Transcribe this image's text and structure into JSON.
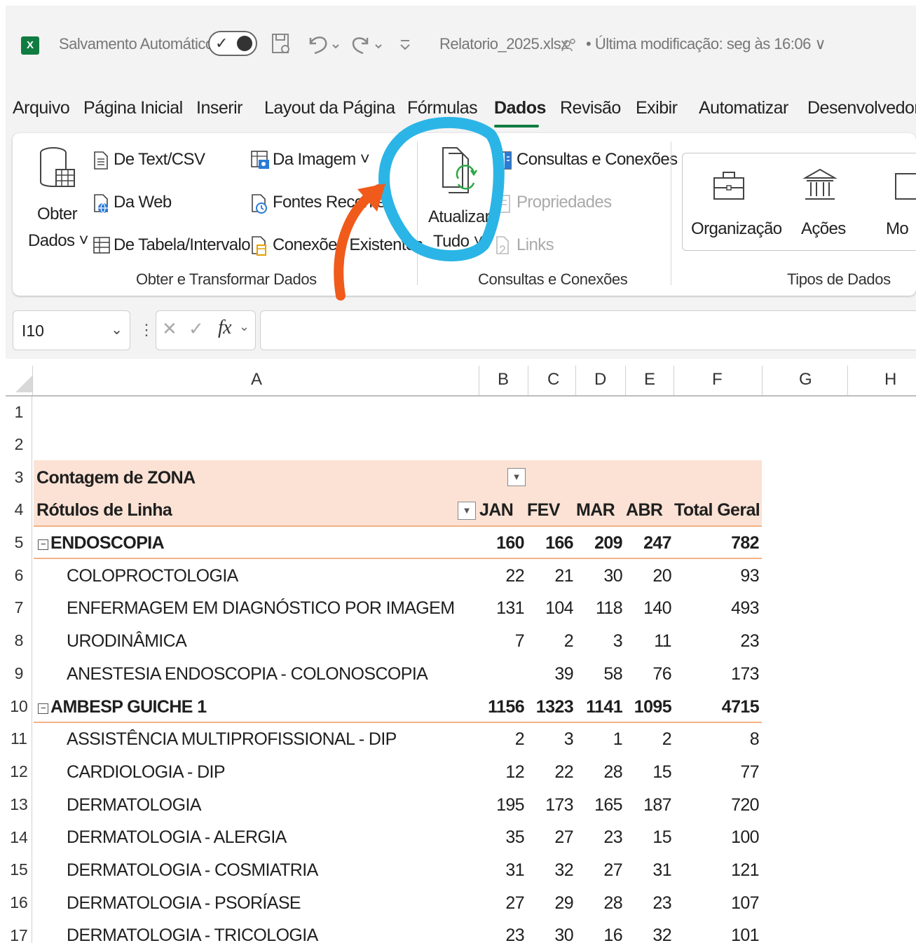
{
  "titlebar": {
    "app_icon": "X",
    "autosave_label": "Salvamento Automático",
    "autosave_check": "✓",
    "filename": "Relatorio_2025.xlsx",
    "modified": "• Última modificação: seg às 16:06 ∨"
  },
  "tabs": [
    "Arquivo",
    "Página Inicial",
    "Inserir",
    "Layout da Página",
    "Fórmulas",
    "Dados",
    "Revisão",
    "Exibir",
    "Automatizar",
    "Desenvolvedor"
  ],
  "ribbon": {
    "get_data": {
      "line1": "Obter",
      "line2": "Dados ˅"
    },
    "from_text": "De Text/CSV",
    "from_web": "Da Web",
    "from_table": "De Tabela/Intervalo",
    "from_image": "Da Imagem ˅",
    "recent_sources": "Fontes Recentes",
    "existing_connections": "Conexões Existentes",
    "group_get_transform": "Obter e Transformar Dados",
    "refresh_all": {
      "line1": "Atualizar",
      "line2": "Tudo ˅"
    },
    "queries_connections": "Consultas e Conexões",
    "properties": "Propriedades",
    "links": "Links",
    "group_queries": "Consultas e Conexões",
    "org": "Organização",
    "stocks": "Ações",
    "more": "Mo",
    "group_datatypes": "Tipos de Dados"
  },
  "formula_bar": {
    "cell_ref": "I10",
    "dropdown": "⌄",
    "colon": "⋮",
    "cancel": "✕",
    "enter": "✓",
    "fx": "fx",
    "chev": "⌄",
    "value": ""
  },
  "columns": [
    "A",
    "B",
    "C",
    "D",
    "E",
    "F",
    "G",
    "H"
  ],
  "row_numbers": [
    "1",
    "2",
    "3",
    "4",
    "5",
    "6",
    "7",
    "8",
    "9",
    "10",
    "11",
    "12",
    "13",
    "14",
    "15",
    "16",
    "17"
  ],
  "pivot": {
    "title": "Contagem de ZONA",
    "row_labels": "Rótulos de Linha",
    "months": [
      "JAN",
      "FEV",
      "MAR",
      "ABR"
    ],
    "total_label": "Total Geral",
    "rows": [
      {
        "label": "ENDOSCOPIA",
        "group": true,
        "v": [
          "160",
          "166",
          "209",
          "247",
          "782"
        ]
      },
      {
        "label": "COLOPROCTOLOGIA",
        "group": false,
        "v": [
          "22",
          "21",
          "30",
          "20",
          "93"
        ]
      },
      {
        "label": "ENFERMAGEM EM DIAGNÓSTICO POR IMAGEM",
        "group": false,
        "v": [
          "131",
          "104",
          "118",
          "140",
          "493"
        ]
      },
      {
        "label": "URODINÂMICA",
        "group": false,
        "v": [
          "7",
          "2",
          "3",
          "11",
          "23"
        ]
      },
      {
        "label": "ANESTESIA ENDOSCOPIA - COLONOSCOPIA",
        "group": false,
        "v": [
          "",
          "39",
          "58",
          "76",
          "173"
        ]
      },
      {
        "label": "AMBESP GUICHE 1",
        "group": true,
        "v": [
          "1156",
          "1323",
          "1141",
          "1095",
          "4715"
        ]
      },
      {
        "label": "ASSISTÊNCIA MULTIPROFISSIONAL - DIP",
        "group": false,
        "v": [
          "2",
          "3",
          "1",
          "2",
          "8"
        ]
      },
      {
        "label": "CARDIOLOGIA - DIP",
        "group": false,
        "v": [
          "12",
          "22",
          "28",
          "15",
          "77"
        ]
      },
      {
        "label": "DERMATOLOGIA",
        "group": false,
        "v": [
          "195",
          "173",
          "165",
          "187",
          "720"
        ]
      },
      {
        "label": "DERMATOLOGIA - ALERGIA",
        "group": false,
        "v": [
          "35",
          "27",
          "23",
          "15",
          "100"
        ]
      },
      {
        "label": "DERMATOLOGIA - COSMIATRIA",
        "group": false,
        "v": [
          "31",
          "32",
          "27",
          "31",
          "121"
        ]
      },
      {
        "label": "DERMATOLOGIA - PSORÍASE",
        "group": false,
        "v": [
          "27",
          "29",
          "28",
          "23",
          "107"
        ]
      },
      {
        "label": "DERMATOLOGIA - TRICOLOGIA",
        "group": false,
        "v": [
          "23",
          "30",
          "16",
          "32",
          "101"
        ]
      }
    ]
  },
  "annotations": {
    "circle_color": "#2bb5e6",
    "arrow_color": "#f05a1a"
  }
}
